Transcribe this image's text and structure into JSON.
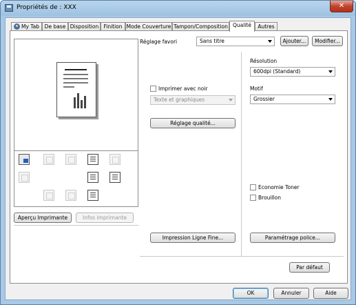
{
  "window": {
    "title": "Propriétés de : XXX",
    "close_glyph": "✕"
  },
  "tabs": [
    {
      "label": "My Tab",
      "icon": "user-icon",
      "active": false
    },
    {
      "label": "De base",
      "active": false
    },
    {
      "label": "Disposition",
      "active": false
    },
    {
      "label": "Finition",
      "active": false
    },
    {
      "label": "Mode Couverture",
      "active": false
    },
    {
      "label": "Tampon/Composition",
      "active": false
    },
    {
      "label": "Qualité",
      "active": true
    },
    {
      "label": "Autres",
      "active": false
    }
  ],
  "favorite": {
    "label": "Réglage favori",
    "value": "Sans titre",
    "add_label": "Ajouter...",
    "modify_label": "Modifier..."
  },
  "left": {
    "printer_view_label": "Aperçu Imprimante",
    "printer_info_label": "Infos imprimante"
  },
  "quality": {
    "print_black_label": "Imprimer avec noir",
    "print_black_checked": false,
    "text_graphics_value": "Texte et graphiques",
    "quality_settings_label": "Réglage qualité...",
    "fine_line_label": "Impression Ligne Fine..."
  },
  "right": {
    "resolution_label": "Résolution",
    "resolution_value": "600dpi (Standard)",
    "pattern_label": "Motif",
    "pattern_value": "Grossier",
    "toner_save_label": "Economie Toner",
    "toner_save_checked": false,
    "draft_label": "Brouillon",
    "draft_checked": false,
    "font_settings_label": "Paramétrage police..."
  },
  "default_button": "Par défaut",
  "footer": {
    "ok": "OK",
    "cancel": "Annuler",
    "help": "Aide"
  },
  "colors": {
    "title_gradient": "#a8c9e6",
    "close_red": "#c2432d",
    "face": "#f0f0f0"
  }
}
